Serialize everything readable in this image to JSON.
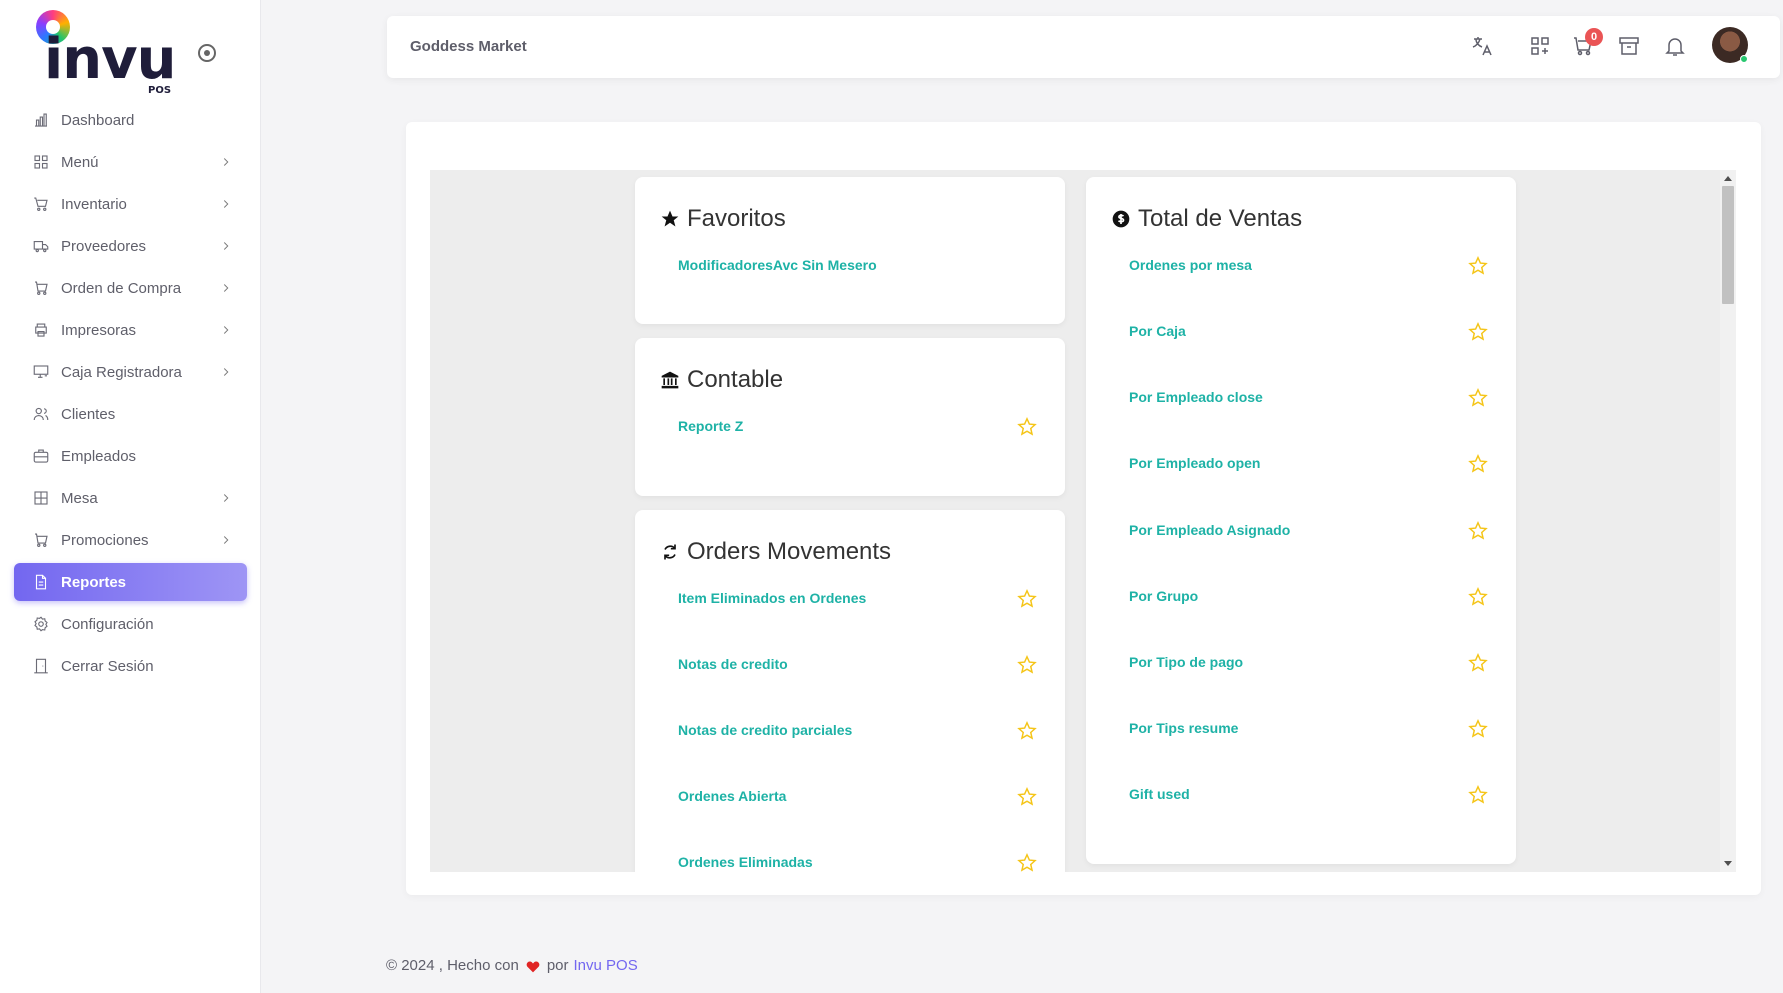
{
  "sidebar": {
    "logo_text": "invu",
    "logo_sub": "POS",
    "items": [
      {
        "label": "Dashboard",
        "icon": "chart-bar-icon",
        "chevron": false,
        "active": false
      },
      {
        "label": "Menú",
        "icon": "grid-icon",
        "chevron": true,
        "active": false
      },
      {
        "label": "Inventario",
        "icon": "cart-icon",
        "chevron": true,
        "active": false
      },
      {
        "label": "Proveedores",
        "icon": "truck-icon",
        "chevron": true,
        "active": false
      },
      {
        "label": "Orden de Compra",
        "icon": "shopping-cart-icon",
        "chevron": true,
        "active": false
      },
      {
        "label": "Impresoras",
        "icon": "printer-icon",
        "chevron": true,
        "active": false
      },
      {
        "label": "Caja Registradora",
        "icon": "register-icon",
        "chevron": true,
        "active": false
      },
      {
        "label": "Clientes",
        "icon": "users-icon",
        "chevron": false,
        "active": false
      },
      {
        "label": "Empleados",
        "icon": "briefcase-icon",
        "chevron": false,
        "active": false
      },
      {
        "label": "Mesa",
        "icon": "table-icon",
        "chevron": true,
        "active": false
      },
      {
        "label": "Promociones",
        "icon": "cart-icon",
        "chevron": true,
        "active": false
      },
      {
        "label": "Reportes",
        "icon": "file-icon",
        "chevron": false,
        "active": true
      },
      {
        "label": "Configuración",
        "icon": "gear-icon",
        "chevron": false,
        "active": false
      },
      {
        "label": "Cerrar Sesión",
        "icon": "door-icon",
        "chevron": false,
        "active": false
      }
    ]
  },
  "topbar": {
    "store_name": "Goddess Market",
    "cart_count": "0",
    "icons": [
      "translate-icon",
      "apps-add-icon",
      "cart-icon",
      "archive-icon",
      "bell-icon",
      "avatar"
    ]
  },
  "panels": {
    "favoritos": {
      "title": "Favoritos",
      "icon": "star-filled-icon",
      "items": [
        "ModificadoresAvc Sin Mesero"
      ]
    },
    "contable": {
      "title": "Contable",
      "icon": "bank-icon",
      "items": [
        "Reporte Z"
      ]
    },
    "orders_movements": {
      "title": "Orders Movements",
      "icon": "refresh-icon",
      "items": [
        "Item Eliminados en Ordenes",
        "Notas de credito",
        "Notas de credito parciales",
        "Ordenes Abierta",
        "Ordenes Eliminadas"
      ]
    },
    "total_ventas": {
      "title": "Total de Ventas",
      "icon": "dollar-circle-icon",
      "items": [
        "Ordenes por mesa",
        "Por Caja",
        "Por Empleado close",
        "Por Empleado open",
        "Por Empleado Asignado",
        "Por Grupo",
        "Por Tipo de pago",
        "Por Tips resume",
        "Gift used"
      ]
    }
  },
  "footer": {
    "text_before": "© 2024 , Hecho con",
    "text_middle": "por",
    "brand": "Invu POS"
  },
  "colors": {
    "accent": "#7367f0",
    "link": "#1eb2a6",
    "star": "#f5c518",
    "badge": "#ea5455"
  }
}
